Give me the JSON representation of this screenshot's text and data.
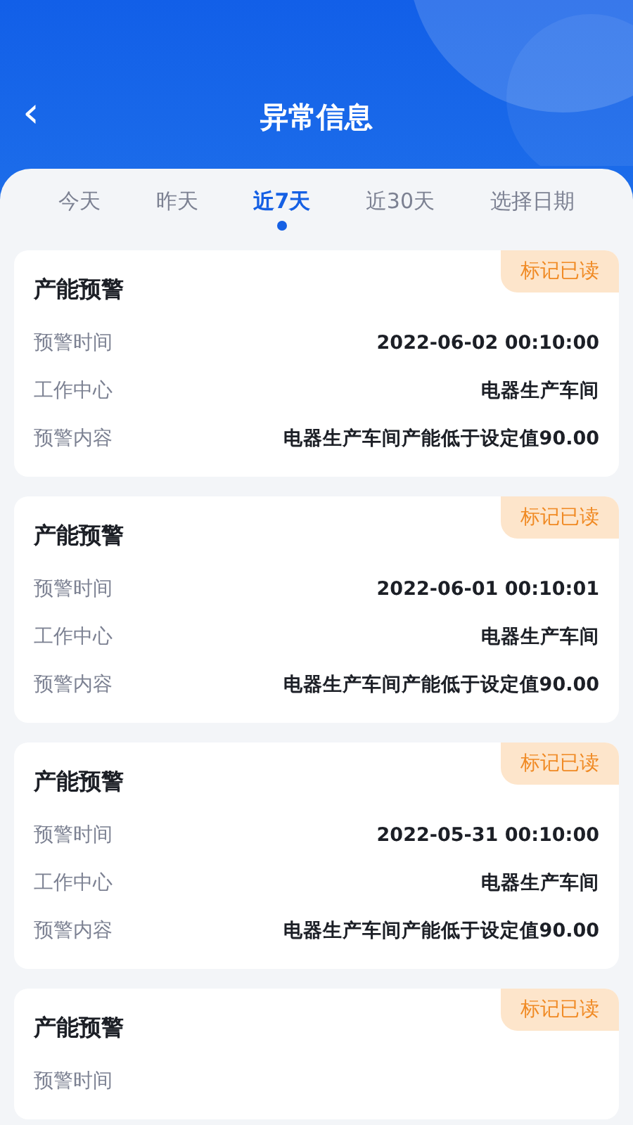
{
  "header": {
    "back": "‹",
    "title": "异常信息"
  },
  "tabs": [
    {
      "label": "今天",
      "selected": false
    },
    {
      "label": "昨天",
      "selected": false
    },
    {
      "label": "近7天",
      "selected": true
    },
    {
      "label": "近30天",
      "selected": false
    },
    {
      "label": "选择日期",
      "selected": false
    }
  ],
  "alerts": [
    {
      "title": "产能预警",
      "action": "标记已读",
      "fields": [
        {
          "label": "预警时间",
          "value": "2022-06-02 00:10:00"
        },
        {
          "label": "工作中心",
          "value": "电器生产车间"
        },
        {
          "label": "预警内容",
          "value": "电器生产车间产能低于设定值90.00"
        }
      ]
    },
    {
      "title": "产能预警",
      "action": "标记已读",
      "fields": [
        {
          "label": "预警时间",
          "value": "2022-06-01 00:10:01"
        },
        {
          "label": "工作中心",
          "value": "电器生产车间"
        },
        {
          "label": "预警内容",
          "value": "电器生产车间产能低于设定值90.00"
        }
      ]
    },
    {
      "title": "产能预警",
      "action": "标记已读",
      "fields": [
        {
          "label": "预警时间",
          "value": "2022-05-31 00:10:00"
        },
        {
          "label": "工作中心",
          "value": "电器生产车间"
        },
        {
          "label": "预警内容",
          "value": "电器生产车间产能低于设定值90.00"
        }
      ]
    },
    {
      "title": "产能预警",
      "action": "标记已读",
      "fields": [
        {
          "label": "预警时间"
        }
      ]
    }
  ]
}
